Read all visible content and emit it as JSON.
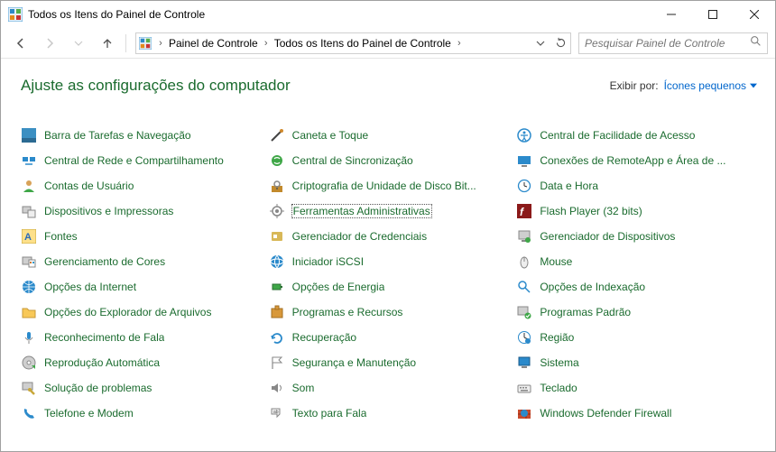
{
  "window": {
    "title": "Todos os Itens do Painel de Controle"
  },
  "breadcrumbs": {
    "level1": "Painel de Controle",
    "level2": "Todos os Itens do Painel de Controle"
  },
  "search": {
    "placeholder": "Pesquisar Painel de Controle"
  },
  "header": {
    "heading": "Ajuste as configurações do computador",
    "viewby_label": "Exibir por:",
    "viewby_value": "Ícones pequenos"
  },
  "items": {
    "c0": {
      "label": "Barra de Tarefas e Navegação"
    },
    "c1": {
      "label": "Central de Rede e Compartilhamento"
    },
    "c2": {
      "label": "Contas de Usuário"
    },
    "c3": {
      "label": "Dispositivos e Impressoras"
    },
    "c4": {
      "label": "Fontes"
    },
    "c5": {
      "label": "Gerenciamento de Cores"
    },
    "c6": {
      "label": "Opções da Internet"
    },
    "c7": {
      "label": "Opções do Explorador de Arquivos"
    },
    "c8": {
      "label": "Reconhecimento de Fala"
    },
    "c9": {
      "label": "Reprodução Automática"
    },
    "c10": {
      "label": "Solução de problemas"
    },
    "c11": {
      "label": "Telefone e Modem"
    },
    "d0": {
      "label": "Caneta e Toque"
    },
    "d1": {
      "label": "Central de Sincronização"
    },
    "d2": {
      "label": "Criptografia de Unidade de Disco Bit..."
    },
    "d3": {
      "label": "Ferramentas Administrativas"
    },
    "d4": {
      "label": "Gerenciador de Credenciais"
    },
    "d5": {
      "label": "Iniciador iSCSI"
    },
    "d6": {
      "label": "Opções de Energia"
    },
    "d7": {
      "label": "Programas e Recursos"
    },
    "d8": {
      "label": "Recuperação"
    },
    "d9": {
      "label": "Segurança e Manutenção"
    },
    "d10": {
      "label": "Som"
    },
    "d11": {
      "label": "Texto para Fala"
    },
    "e0": {
      "label": "Central de Facilidade de Acesso"
    },
    "e1": {
      "label": "Conexões de RemoteApp e Área de ..."
    },
    "e2": {
      "label": "Data e Hora"
    },
    "e3": {
      "label": "Flash Player (32 bits)"
    },
    "e4": {
      "label": "Gerenciador de Dispositivos"
    },
    "e5": {
      "label": "Mouse"
    },
    "e6": {
      "label": "Opções de Indexação"
    },
    "e7": {
      "label": "Programas Padrão"
    },
    "e8": {
      "label": "Região"
    },
    "e9": {
      "label": "Sistema"
    },
    "e10": {
      "label": "Teclado"
    },
    "e11": {
      "label": "Windows Defender Firewall"
    }
  }
}
